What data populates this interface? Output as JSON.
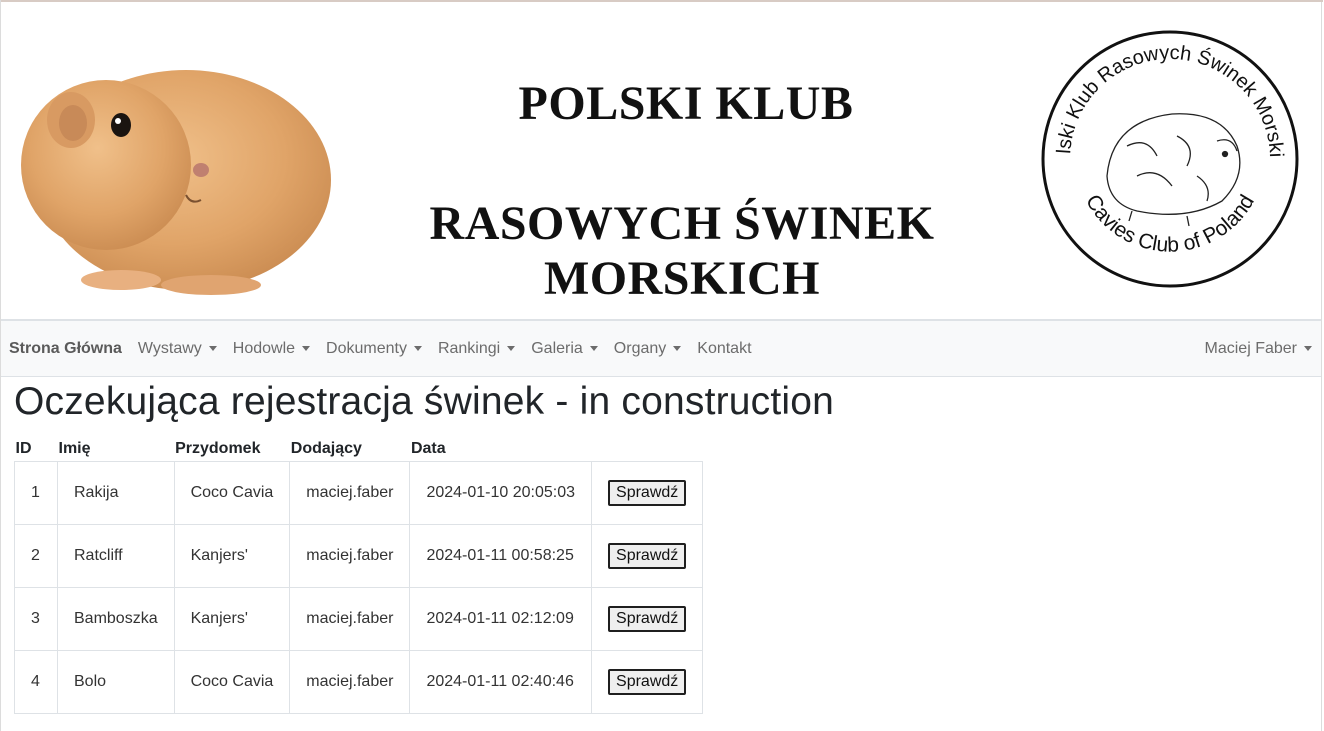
{
  "banner": {
    "title_line1": "POLSKI KLUB",
    "title_line2": "RASOWYCH ŚWINEK MORSKICH",
    "seal_top_text": "Polski Klub Rasowych Świnek Morskich",
    "seal_bottom_text": "Cavies Club of Poland",
    "left_image": "guinea-pig-photo",
    "right_image": "club-seal-logo"
  },
  "navbar": {
    "brand": "Strona Główna",
    "items": [
      {
        "label": "Wystawy",
        "dropdown": true
      },
      {
        "label": "Hodowle",
        "dropdown": true
      },
      {
        "label": "Dokumenty",
        "dropdown": true
      },
      {
        "label": "Rankingi",
        "dropdown": true
      },
      {
        "label": "Galeria",
        "dropdown": true
      },
      {
        "label": "Organy",
        "dropdown": true
      },
      {
        "label": "Kontakt",
        "dropdown": false
      }
    ],
    "user": "Maciej Faber"
  },
  "main": {
    "title": "Oczekująca rejestracja świnek - in construction",
    "table": {
      "headers": [
        "ID",
        "Imię",
        "Przydomek",
        "Dodający",
        "Data"
      ],
      "rows": [
        {
          "id": "1",
          "name": "Rakija",
          "prefix": "Coco Cavia",
          "added_by": "maciej.faber",
          "date": "2024-01-10 20:05:03",
          "action": "Sprawdź"
        },
        {
          "id": "2",
          "name": "Ratcliff",
          "prefix": "Kanjers'",
          "added_by": "maciej.faber",
          "date": "2024-01-11 00:58:25",
          "action": "Sprawdź"
        },
        {
          "id": "3",
          "name": "Bamboszka",
          "prefix": "Kanjers'",
          "added_by": "maciej.faber",
          "date": "2024-01-11 02:12:09",
          "action": "Sprawdź"
        },
        {
          "id": "4",
          "name": "Bolo",
          "prefix": "Coco Cavia",
          "added_by": "maciej.faber",
          "date": "2024-01-11 02:40:46",
          "action": "Sprawdź"
        }
      ]
    }
  },
  "colors": {
    "navbar_bg": "#f8f9fa",
    "nav_text": "#6c6c6c",
    "border": "#dee2e6",
    "guinea_pig_fur": "#e0a870"
  }
}
